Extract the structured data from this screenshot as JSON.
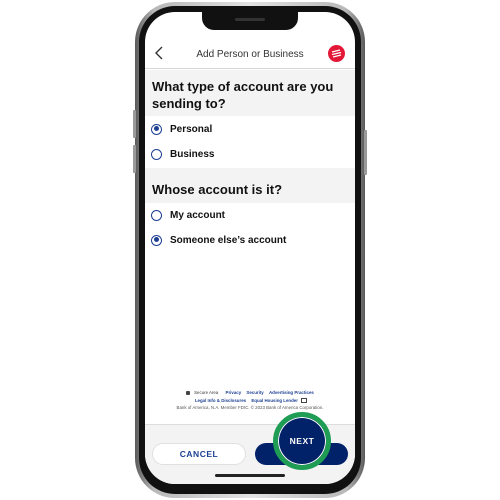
{
  "nav": {
    "title": "Add Person or Business",
    "back_icon": "chevron-left-icon",
    "logo_icon": "bank-logo-icon"
  },
  "account_type": {
    "question": "What type of account are you sending to?",
    "options": [
      {
        "label": "Personal",
        "selected": true
      },
      {
        "label": "Business",
        "selected": false
      }
    ]
  },
  "owner": {
    "question": "Whose account is it?",
    "options": [
      {
        "label": "My account",
        "selected": false
      },
      {
        "label": "Someone else’s account",
        "selected": true
      }
    ]
  },
  "footer": {
    "secure_area": "Secure Area",
    "links": [
      "Privacy",
      "Security",
      "Advertising Practices"
    ],
    "links2": [
      "Legal Info & Disclosures",
      "Equal Housing Lender"
    ],
    "legal": "Bank of America, N.A. Member FDIC. © 2023 Bank of America Corporation."
  },
  "actions": {
    "cancel": "CANCEL",
    "next": "NEXT"
  },
  "colors": {
    "primary": "#012169",
    "brand_red": "#e31837",
    "highlight": "#1f9d55"
  }
}
